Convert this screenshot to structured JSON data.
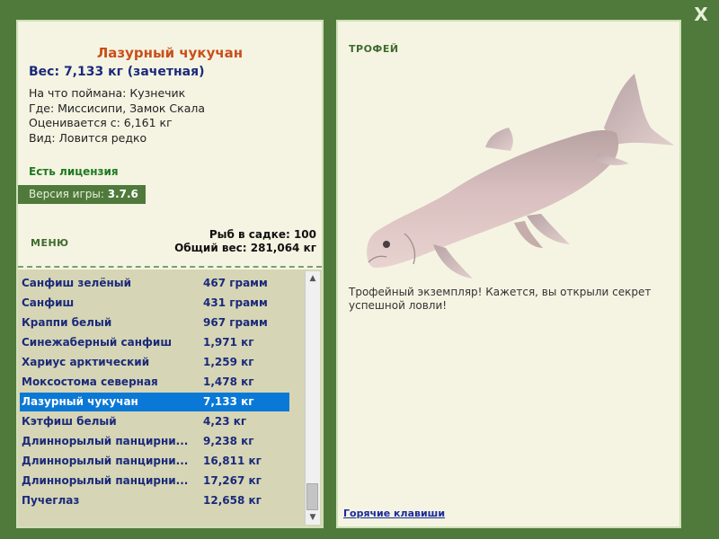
{
  "window": {
    "close_label": "X"
  },
  "selected_fish": {
    "name": "Лазурный чукучан",
    "weight_line": "Вес: 7,133 кг (зачетная)",
    "caught_on": "На что поймана: Кузнечик",
    "location": "Где: Миссисипи, Замок Скала",
    "rated_from": "Оценивается с: 6,161 кг",
    "rarity": "Вид: Ловится редко"
  },
  "license": "Есть лицензия",
  "version": {
    "label": "Версия игры: ",
    "value": "3.7.6"
  },
  "menu_label": "МЕНЮ",
  "keepnet": {
    "count_line": "Рыб в садке: 100",
    "total_line": "Общий вес: 281,064 кг"
  },
  "fish_list": [
    {
      "name": "Санфиш зелёный",
      "weight": "467 грамм"
    },
    {
      "name": "Санфиш",
      "weight": "431 грамм"
    },
    {
      "name": "Краппи белый",
      "weight": "967 грамм"
    },
    {
      "name": "Синежаберный санфиш",
      "weight": "1,971 кг"
    },
    {
      "name": "Хариус арктический",
      "weight": "1,259 кг"
    },
    {
      "name": "Моксостома северная",
      "weight": "1,478 кг"
    },
    {
      "name": "Лазурный чукучан",
      "weight": "7,133 кг",
      "selected": true
    },
    {
      "name": "Кэтфиш белый",
      "weight": "4,23 кг"
    },
    {
      "name": "Длиннорылый панцирни...",
      "weight": "9,238 кг"
    },
    {
      "name": "Длиннорылый панцирни...",
      "weight": "16,811 кг"
    },
    {
      "name": "Длиннорылый панцирни...",
      "weight": "17,267 кг"
    },
    {
      "name": "Пучеглаз",
      "weight": "12,658 кг"
    }
  ],
  "trophy": {
    "label": "ТРОФЕЙ",
    "description": "Трофейный экземпляр! Кажется, вы открыли секрет успешной ловли!"
  },
  "hotkeys_label": "Горячие клавиши",
  "colors": {
    "background": "#4f7a3c",
    "panel": "#f5f4e3",
    "accent_name": "#c8501a",
    "list_text": "#1b2a7a",
    "selection": "#0a78d6"
  },
  "icons": {
    "close": "close-icon",
    "scroll_up": "scroll-up-arrow-icon",
    "scroll_down": "scroll-down-arrow-icon",
    "fish": "fish-illustration"
  }
}
